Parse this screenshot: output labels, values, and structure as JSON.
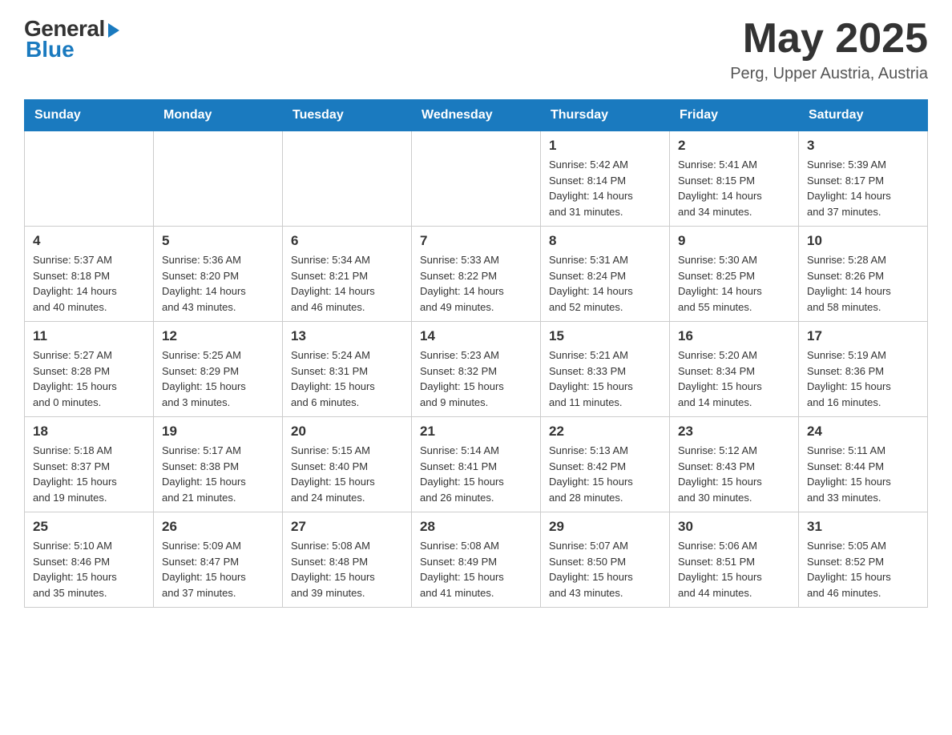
{
  "header": {
    "logo_general": "General",
    "logo_blue": "Blue",
    "month_title": "May 2025",
    "location": "Perg, Upper Austria, Austria"
  },
  "days_of_week": [
    "Sunday",
    "Monday",
    "Tuesday",
    "Wednesday",
    "Thursday",
    "Friday",
    "Saturday"
  ],
  "weeks": [
    [
      {
        "day": "",
        "info": ""
      },
      {
        "day": "",
        "info": ""
      },
      {
        "day": "",
        "info": ""
      },
      {
        "day": "",
        "info": ""
      },
      {
        "day": "1",
        "info": "Sunrise: 5:42 AM\nSunset: 8:14 PM\nDaylight: 14 hours\nand 31 minutes."
      },
      {
        "day": "2",
        "info": "Sunrise: 5:41 AM\nSunset: 8:15 PM\nDaylight: 14 hours\nand 34 minutes."
      },
      {
        "day": "3",
        "info": "Sunrise: 5:39 AM\nSunset: 8:17 PM\nDaylight: 14 hours\nand 37 minutes."
      }
    ],
    [
      {
        "day": "4",
        "info": "Sunrise: 5:37 AM\nSunset: 8:18 PM\nDaylight: 14 hours\nand 40 minutes."
      },
      {
        "day": "5",
        "info": "Sunrise: 5:36 AM\nSunset: 8:20 PM\nDaylight: 14 hours\nand 43 minutes."
      },
      {
        "day": "6",
        "info": "Sunrise: 5:34 AM\nSunset: 8:21 PM\nDaylight: 14 hours\nand 46 minutes."
      },
      {
        "day": "7",
        "info": "Sunrise: 5:33 AM\nSunset: 8:22 PM\nDaylight: 14 hours\nand 49 minutes."
      },
      {
        "day": "8",
        "info": "Sunrise: 5:31 AM\nSunset: 8:24 PM\nDaylight: 14 hours\nand 52 minutes."
      },
      {
        "day": "9",
        "info": "Sunrise: 5:30 AM\nSunset: 8:25 PM\nDaylight: 14 hours\nand 55 minutes."
      },
      {
        "day": "10",
        "info": "Sunrise: 5:28 AM\nSunset: 8:26 PM\nDaylight: 14 hours\nand 58 minutes."
      }
    ],
    [
      {
        "day": "11",
        "info": "Sunrise: 5:27 AM\nSunset: 8:28 PM\nDaylight: 15 hours\nand 0 minutes."
      },
      {
        "day": "12",
        "info": "Sunrise: 5:25 AM\nSunset: 8:29 PM\nDaylight: 15 hours\nand 3 minutes."
      },
      {
        "day": "13",
        "info": "Sunrise: 5:24 AM\nSunset: 8:31 PM\nDaylight: 15 hours\nand 6 minutes."
      },
      {
        "day": "14",
        "info": "Sunrise: 5:23 AM\nSunset: 8:32 PM\nDaylight: 15 hours\nand 9 minutes."
      },
      {
        "day": "15",
        "info": "Sunrise: 5:21 AM\nSunset: 8:33 PM\nDaylight: 15 hours\nand 11 minutes."
      },
      {
        "day": "16",
        "info": "Sunrise: 5:20 AM\nSunset: 8:34 PM\nDaylight: 15 hours\nand 14 minutes."
      },
      {
        "day": "17",
        "info": "Sunrise: 5:19 AM\nSunset: 8:36 PM\nDaylight: 15 hours\nand 16 minutes."
      }
    ],
    [
      {
        "day": "18",
        "info": "Sunrise: 5:18 AM\nSunset: 8:37 PM\nDaylight: 15 hours\nand 19 minutes."
      },
      {
        "day": "19",
        "info": "Sunrise: 5:17 AM\nSunset: 8:38 PM\nDaylight: 15 hours\nand 21 minutes."
      },
      {
        "day": "20",
        "info": "Sunrise: 5:15 AM\nSunset: 8:40 PM\nDaylight: 15 hours\nand 24 minutes."
      },
      {
        "day": "21",
        "info": "Sunrise: 5:14 AM\nSunset: 8:41 PM\nDaylight: 15 hours\nand 26 minutes."
      },
      {
        "day": "22",
        "info": "Sunrise: 5:13 AM\nSunset: 8:42 PM\nDaylight: 15 hours\nand 28 minutes."
      },
      {
        "day": "23",
        "info": "Sunrise: 5:12 AM\nSunset: 8:43 PM\nDaylight: 15 hours\nand 30 minutes."
      },
      {
        "day": "24",
        "info": "Sunrise: 5:11 AM\nSunset: 8:44 PM\nDaylight: 15 hours\nand 33 minutes."
      }
    ],
    [
      {
        "day": "25",
        "info": "Sunrise: 5:10 AM\nSunset: 8:46 PM\nDaylight: 15 hours\nand 35 minutes."
      },
      {
        "day": "26",
        "info": "Sunrise: 5:09 AM\nSunset: 8:47 PM\nDaylight: 15 hours\nand 37 minutes."
      },
      {
        "day": "27",
        "info": "Sunrise: 5:08 AM\nSunset: 8:48 PM\nDaylight: 15 hours\nand 39 minutes."
      },
      {
        "day": "28",
        "info": "Sunrise: 5:08 AM\nSunset: 8:49 PM\nDaylight: 15 hours\nand 41 minutes."
      },
      {
        "day": "29",
        "info": "Sunrise: 5:07 AM\nSunset: 8:50 PM\nDaylight: 15 hours\nand 43 minutes."
      },
      {
        "day": "30",
        "info": "Sunrise: 5:06 AM\nSunset: 8:51 PM\nDaylight: 15 hours\nand 44 minutes."
      },
      {
        "day": "31",
        "info": "Sunrise: 5:05 AM\nSunset: 8:52 PM\nDaylight: 15 hours\nand 46 minutes."
      }
    ]
  ]
}
